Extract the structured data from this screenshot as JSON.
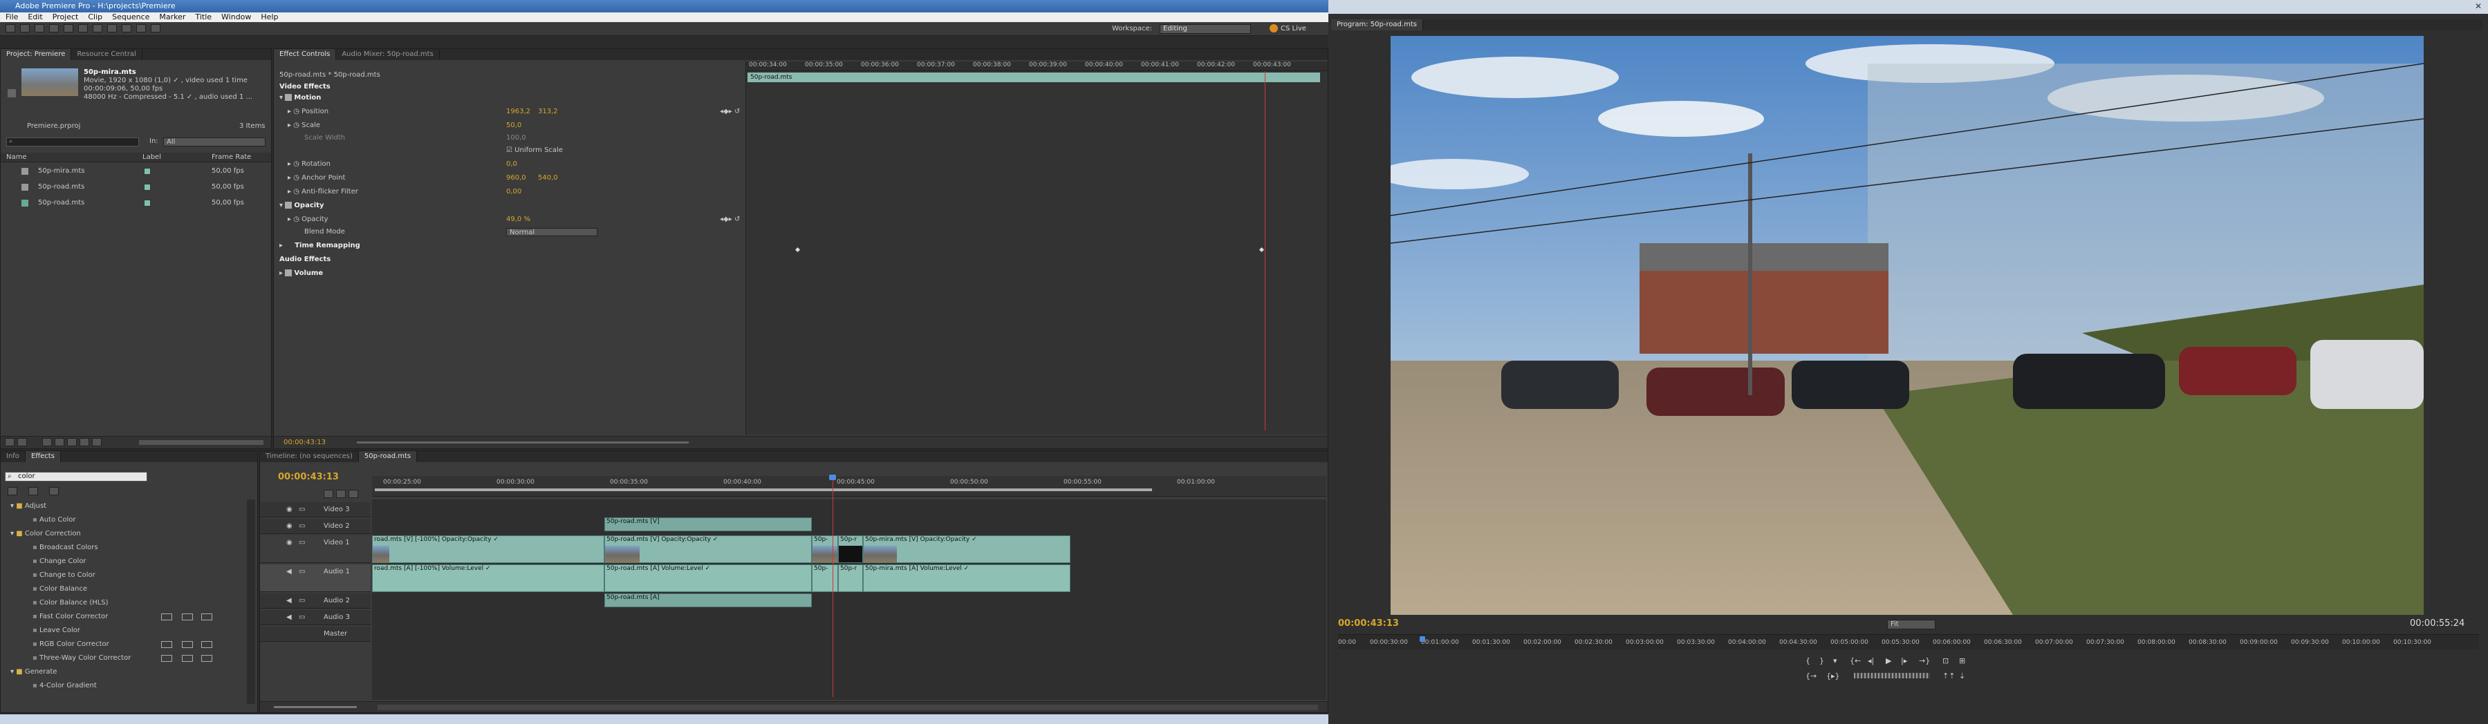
{
  "premiere": {
    "title": "Adobe Premiere Pro - H:\\projects\\Premiere",
    "menu": [
      "File",
      "Edit",
      "Project",
      "Clip",
      "Sequence",
      "Marker",
      "Title",
      "Window",
      "Help"
    ],
    "workspace_label": "Workspace:",
    "workspace_value": "Editing",
    "cs_live": "CS Live"
  },
  "project": {
    "tabs": [
      "Project: Premiere",
      "Resource Central"
    ],
    "clip_name": "50p-mira.mts",
    "clip_info_1": "Movie, 1920 x 1080 (1,0) ✓ , video used 1 time",
    "clip_info_2": "00:00:09:06, 50,00 fps",
    "clip_info_3": "48000 Hz - Compressed - 5.1 ✓ , audio used 1 ...",
    "project_file": "Premiere.prproj",
    "items_count": "3 Items",
    "in_label": "In:",
    "in_value": "All",
    "columns": [
      "Name",
      "Label",
      "Frame Rate"
    ],
    "rows": [
      {
        "name": "50p-mira.mts",
        "rate": "50,00 fps"
      },
      {
        "name": "50p-road.mts",
        "rate": "50,00 fps"
      },
      {
        "name": "50p-road.mts",
        "rate": "50,00 fps"
      }
    ]
  },
  "effect_controls": {
    "tabs": [
      "Effect Controls",
      "Audio Mixer: 50p-road.mts"
    ],
    "clip_path": "50p-road.mts * 50p-road.mts",
    "ruler": [
      "00:00:34:00",
      "00:00:35:00",
      "00:00:36:00",
      "00:00:37:00",
      "00:00:38:00",
      "00:00:39:00",
      "00:00:40:00",
      "00:00:41:00",
      "00:00:42:00",
      "00:00:43:00"
    ],
    "lane_clip": "50p-road.mts",
    "video_effects": "Video Effects",
    "motion": "Motion",
    "position_label": "Position",
    "position_x": "1963,2",
    "position_y": "313,2",
    "scale_label": "Scale",
    "scale_value": "50,0",
    "scale_width_label": "Scale Width",
    "scale_width_value": "100,0",
    "uniform_scale": "Uniform Scale",
    "rotation_label": "Rotation",
    "rotation_value": "0,0",
    "anchor_label": "Anchor Point",
    "anchor_x": "960,0",
    "anchor_y": "540,0",
    "antiflicker_label": "Anti-flicker Filter",
    "antiflicker_value": "0,00",
    "opacity_group": "Opacity",
    "opacity_label": "Opacity",
    "opacity_value": "49,0 %",
    "blend_label": "Blend Mode",
    "blend_value": "Normal",
    "time_remapping": "Time Remapping",
    "audio_effects": "Audio Effects",
    "volume": "Volume",
    "timecode": "00:00:43:13"
  },
  "effects_panel": {
    "tabs": [
      "Info",
      "Effects"
    ],
    "search_value": "color",
    "tree": [
      {
        "label": "Adjust",
        "level": 1,
        "folder": true
      },
      {
        "label": "Auto Color",
        "level": 2
      },
      {
        "label": "Color Correction",
        "level": 1,
        "folder": true
      },
      {
        "label": "Broadcast Colors",
        "level": 2
      },
      {
        "label": "Change Color",
        "level": 2
      },
      {
        "label": "Change to Color",
        "level": 2
      },
      {
        "label": "Color Balance",
        "level": 2
      },
      {
        "label": "Color Balance (HLS)",
        "level": 2
      },
      {
        "label": "Fast Color Corrector",
        "level": 2
      },
      {
        "label": "Leave Color",
        "level": 2
      },
      {
        "label": "RGB Color Corrector",
        "level": 2
      },
      {
        "label": "Three-Way Color Corrector",
        "level": 2
      },
      {
        "label": "Generate",
        "level": 1,
        "folder": true
      },
      {
        "label": "4-Color Gradient",
        "level": 2
      }
    ]
  },
  "timeline": {
    "tabs": [
      "Timeline: (no sequences)",
      "50p-road.mts"
    ],
    "timecode": "00:00:43:13",
    "ruler": [
      "00:00:25:00",
      "00:00:30:00",
      "00:00:35:00",
      "00:00:40:00",
      "00:00:45:00",
      "00:00:50:00",
      "00:00:55:00",
      "00:01:00:00"
    ],
    "tracks": [
      "Video 3",
      "Video 2",
      "Video 1",
      "Audio 1",
      "Audio 2",
      "Audio 3",
      "Master"
    ],
    "clips_v1": [
      {
        "label": "road.mts [V] [-100%] Opacity:Opacity ✓"
      },
      {
        "label": "50p-road.mts [V] Opacity:Opacity ✓"
      },
      {
        "label": "50p-"
      },
      {
        "label": "50p-r"
      },
      {
        "label": "50p-mira.mts [V] Opacity:Opacity ✓"
      }
    ],
    "clip_v2": "50p-road.mts [V]",
    "clips_a1": [
      {
        "label": "road.mts [A] [-100%] Volume:Level ✓"
      },
      {
        "label": "50p-road.mts [A] Volume:Level ✓"
      },
      {
        "label": "50p-"
      },
      {
        "label": "50p-r"
      },
      {
        "label": "50p-mira.mts [A] Volume:Level ✓"
      }
    ],
    "clip_a2": "50p-road.mts [A]"
  },
  "program": {
    "tab": "Program: 50p-road.mts",
    "timecode_current": "00:00:43:13",
    "timecode_duration": "00:00:55:24",
    "fit": "Fit",
    "ruler": [
      "00:00",
      "00:00:30:00",
      "00:01:00:00",
      "00:01:30:00",
      "00:02:00:00",
      "00:02:30:00",
      "00:03:00:00",
      "00:03:30:00",
      "00:04:00:00",
      "00:04:30:00",
      "00:05:00:00",
      "00:05:30:00",
      "00:06:00:00",
      "00:06:30:00",
      "00:07:00:00",
      "00:07:30:00",
      "00:08:00:00",
      "00:08:30:00",
      "00:09:00:00",
      "00:09:30:00",
      "00:10:00:00",
      "00:10:30:00"
    ]
  },
  "colors": {
    "timecode": "#d7a72c",
    "clip": "#8ab9b0",
    "playhead": "#c83a3a"
  }
}
